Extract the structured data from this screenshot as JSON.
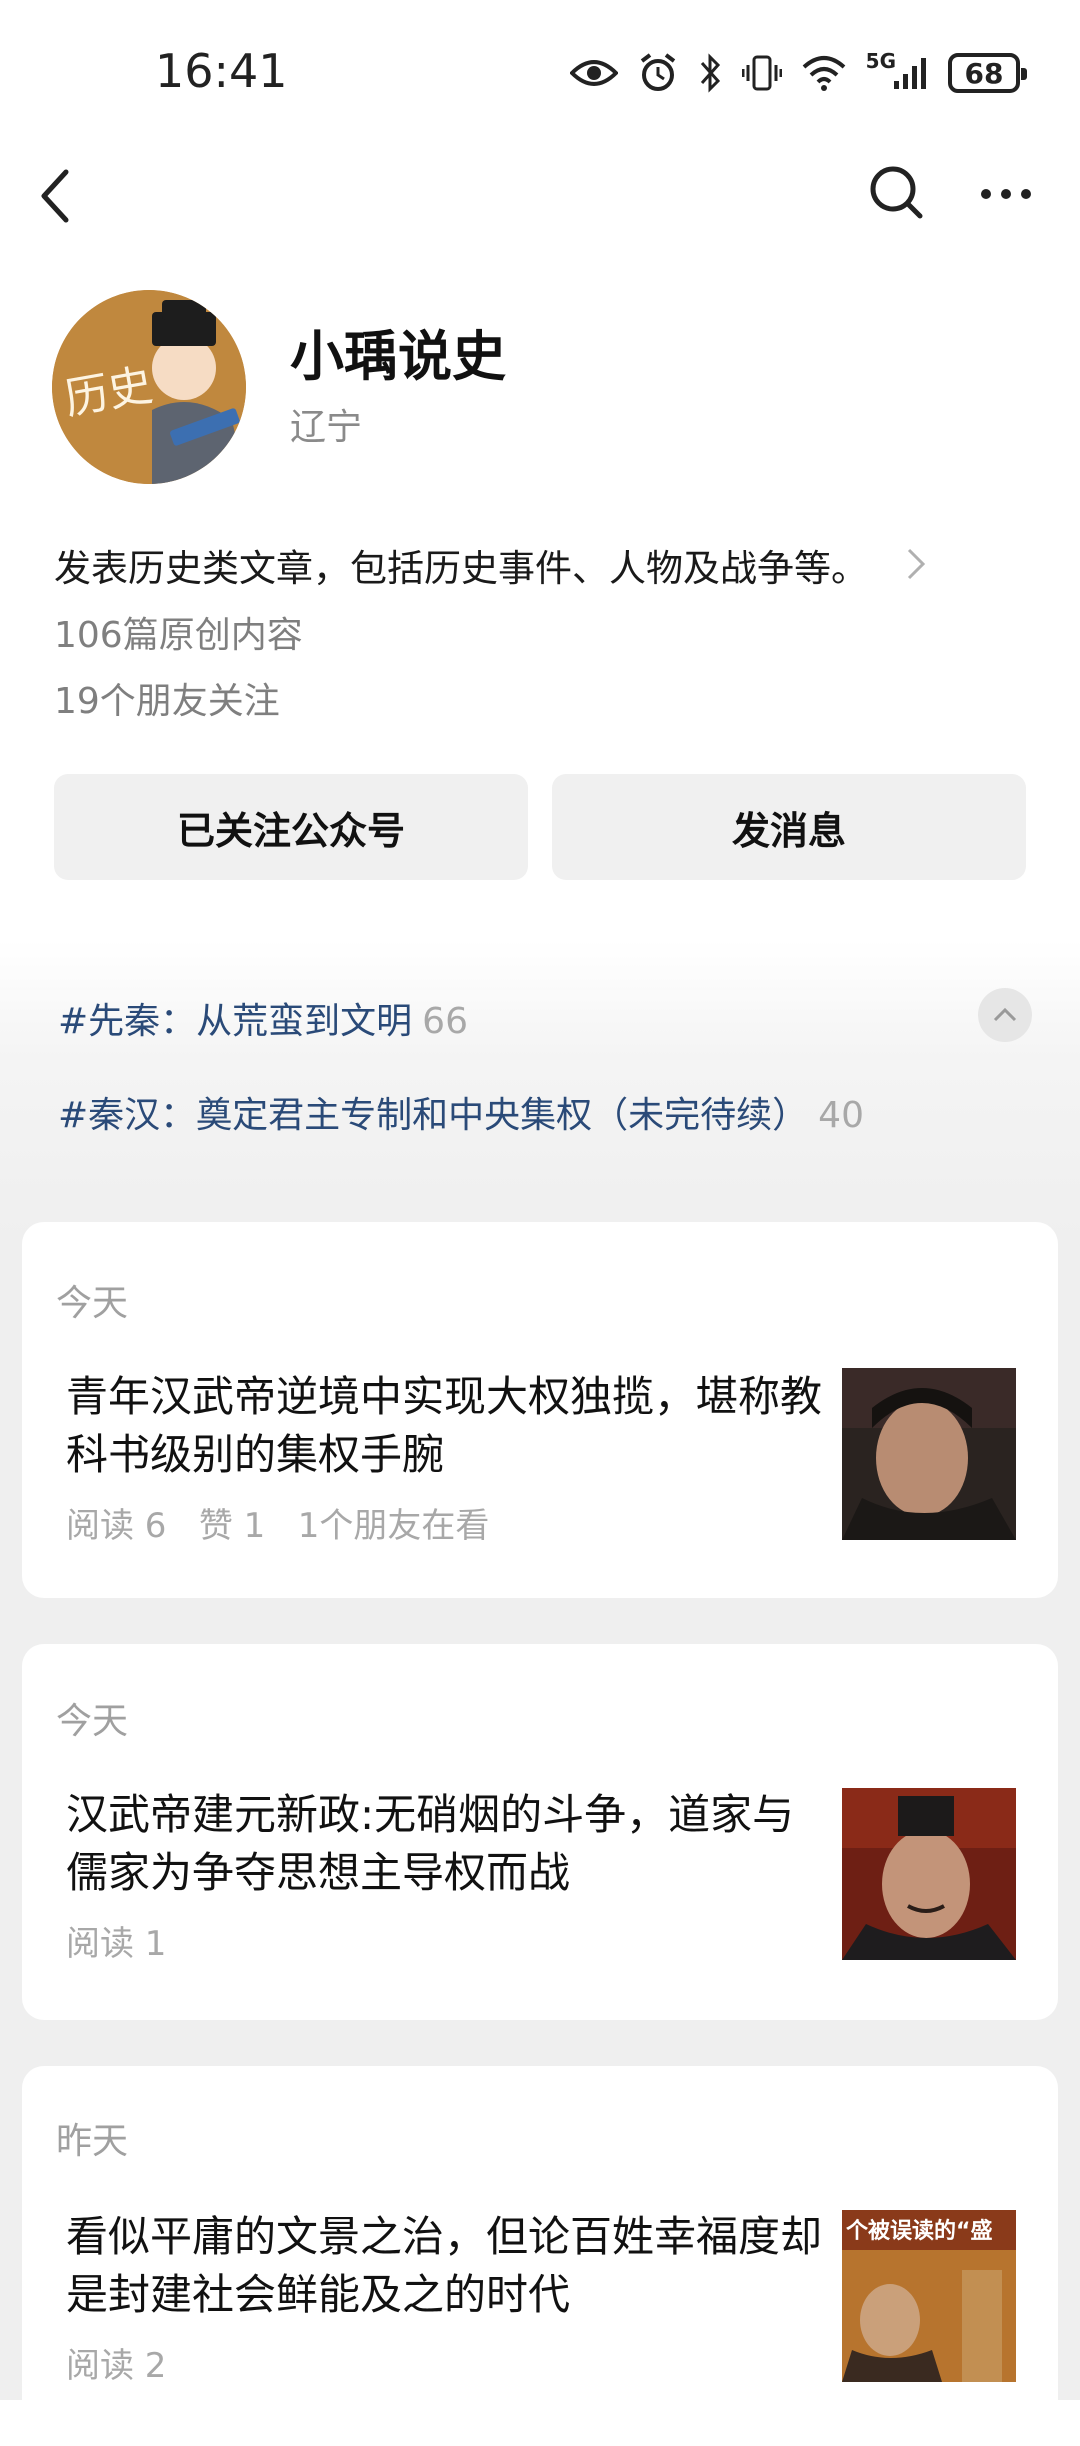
{
  "status_bar": {
    "time": "16:41",
    "network_type": "5G",
    "battery": "68",
    "icons": [
      "eye-icon",
      "alarm-icon",
      "bluetooth-icon",
      "vibrate-icon",
      "wifi-icon",
      "signal-icon",
      "battery-icon"
    ]
  },
  "nav": {
    "icons": [
      "back-arrow-icon",
      "search-icon",
      "more-icon"
    ]
  },
  "profile": {
    "name": "小瑀说史",
    "location": "辽宁",
    "avatar_text": "历史",
    "description": "发表历史类文章，包括历史事件、人物及战争等。",
    "original_count": "106篇原创内容",
    "friends_following": "19个朋友关注"
  },
  "actions": {
    "follow_label": "已关注公众号",
    "message_label": "发消息"
  },
  "topics": [
    {
      "name": "#先秦：从荒蛮到文明",
      "count": "66"
    },
    {
      "name": "#秦汉：奠定君主专制和中央集权（未完待续）",
      "count": "40"
    }
  ],
  "articles": [
    {
      "date": "今天",
      "title": "青年汉武帝逆境中实现大权独揽，堪称教科书级别的集权手腕",
      "meta": "阅读 6   赞 1   1个朋友在看"
    },
    {
      "date": "今天",
      "title": "汉武帝建元新政:无硝烟的斗争，道家与儒家为争夺思想主导权而战",
      "meta": "阅读 1"
    },
    {
      "date": "昨天",
      "title": "看似平庸的文景之治，但论百姓幸福度却是封建社会鲜能及之的时代",
      "meta": "阅读 2"
    }
  ],
  "thumb3_overlay": "个被误读的“盛",
  "colors": {
    "topic_blue": "#2a4a78",
    "muted_gray": "#a8a8a8",
    "button_bg": "#f0f0f0"
  }
}
